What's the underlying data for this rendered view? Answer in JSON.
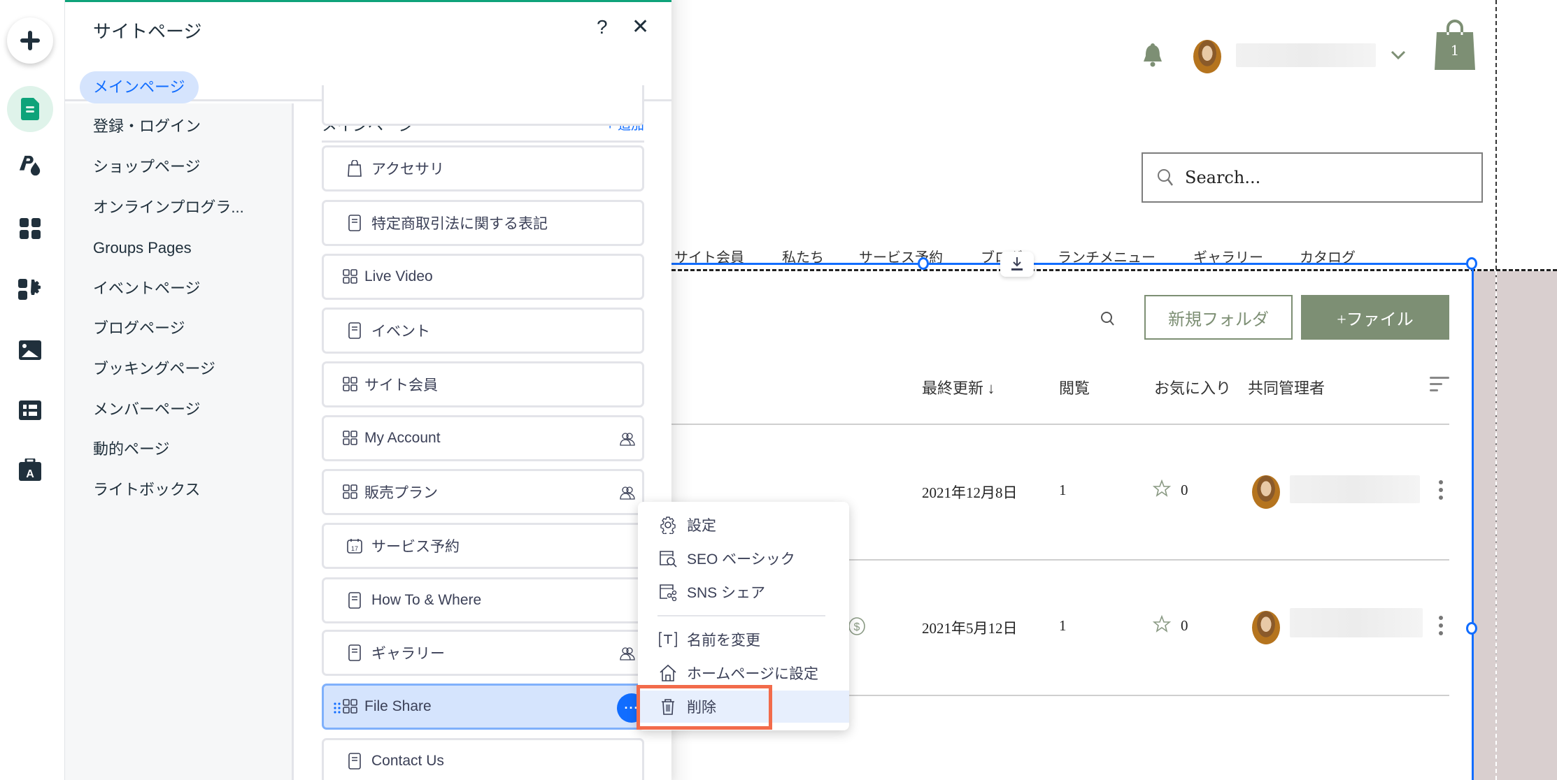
{
  "rail": {
    "items": [
      {
        "name": "add-elements",
        "icon": "plus-icon"
      },
      {
        "name": "pages",
        "icon": "page-icon",
        "active": true
      },
      {
        "name": "design",
        "icon": "theme-icon"
      },
      {
        "name": "apps",
        "icon": "apps-grid-icon"
      },
      {
        "name": "app-settings",
        "icon": "apps-gear-icon"
      },
      {
        "name": "media",
        "icon": "image-icon"
      },
      {
        "name": "cms",
        "icon": "table-icon"
      },
      {
        "name": "business",
        "icon": "portfolio-icon"
      }
    ]
  },
  "panel": {
    "title": "サイトページ",
    "help_label": "?",
    "close_label": "✕",
    "categories": [
      {
        "label": "メインページ",
        "active": true
      },
      {
        "label": "登録・ログイン"
      },
      {
        "label": "ショップページ"
      },
      {
        "label": "オンラインプログラ..."
      },
      {
        "label": "Groups Pages"
      },
      {
        "label": "イベントページ"
      },
      {
        "label": "ブログページ"
      },
      {
        "label": "ブッキングページ"
      },
      {
        "label": "メンバーページ"
      },
      {
        "label": "動的ページ"
      },
      {
        "label": "ライトボックス"
      }
    ],
    "pages_header": "メインページ",
    "add_label": "+ 追加",
    "pages": [
      {
        "label": "",
        "icon": "page-icon"
      },
      {
        "label": "アクセサリ",
        "icon": "shopping-bag-icon"
      },
      {
        "label": "特定商取引法に関する表記",
        "icon": "page-icon"
      },
      {
        "label": "Live Video",
        "icon": "app-page-icon"
      },
      {
        "label": "イベント",
        "icon": "page-icon"
      },
      {
        "label": "サイト会員",
        "icon": "app-page-icon"
      },
      {
        "label": "My Account",
        "icon": "app-page-icon",
        "members_only": true
      },
      {
        "label": "販売プラン",
        "icon": "app-page-icon",
        "members_only": true
      },
      {
        "label": "サービス予約",
        "icon": "calendar-icon"
      },
      {
        "label": "How To & Where",
        "icon": "page-icon"
      },
      {
        "label": "ギャラリー",
        "icon": "page-icon",
        "members_only": true
      },
      {
        "label": "File Share",
        "icon": "app-page-icon",
        "selected": true
      },
      {
        "label": "Contact Us",
        "icon": "page-icon"
      }
    ],
    "calendar_day": "17",
    "more_label": "···"
  },
  "context_menu": {
    "items": [
      {
        "label": "設定",
        "icon": "gear-icon"
      },
      {
        "label": "SEO ベーシック",
        "icon": "seo-icon"
      },
      {
        "label": "SNS シェア",
        "icon": "social-share-icon"
      },
      {
        "label": "名前を変更",
        "icon": "rename-icon"
      },
      {
        "label": "ホームページに設定",
        "icon": "home-icon"
      },
      {
        "label": "削除",
        "icon": "trash-icon",
        "highlighted": true
      }
    ]
  },
  "site": {
    "cart_count": "1",
    "search_placeholder": "Search...",
    "nav": [
      "サイト会員",
      "私たち",
      "サービス予約",
      "ブログ",
      "ランチメニュー",
      "ギャラリー",
      "カタログ"
    ],
    "new_folder_label": "新規フォルダ",
    "add_file_label": "+ファイル",
    "columns": [
      "最終更新 ↓",
      "閲覧",
      "お気に入り",
      "共同管理者"
    ],
    "rows": [
      {
        "date": "2021年12月8日",
        "views": "1",
        "favorites": "0"
      },
      {
        "date": "2021年5月12日",
        "views": "1",
        "favorites": "0"
      }
    ],
    "colors": {
      "accent": "#7d8f74",
      "selection": "#116dff",
      "highlight": "#f26b4b",
      "gutter": "#d9cfcf"
    }
  }
}
